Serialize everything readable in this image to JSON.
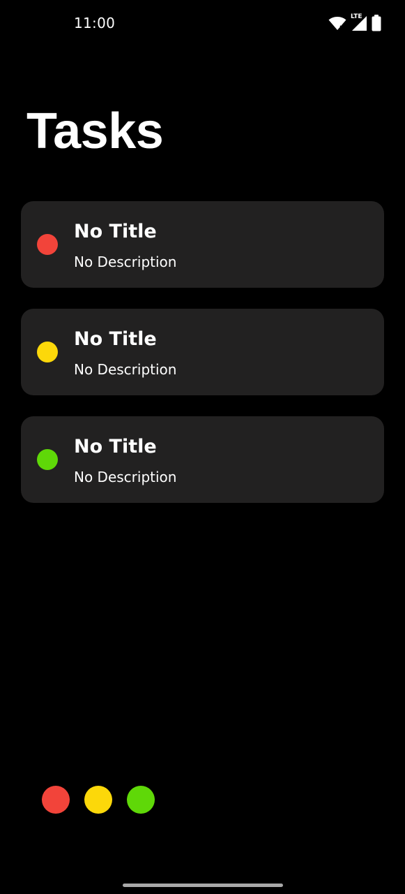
{
  "status_bar": {
    "time": "11:00",
    "network_label": "LTE",
    "icons": [
      "wifi-icon",
      "cell-signal-icon",
      "battery-icon"
    ]
  },
  "header": {
    "title": "Tasks"
  },
  "tasks": [
    {
      "title": "No Title",
      "description": "No Description",
      "color": "#f2443a"
    },
    {
      "title": "No Title",
      "description": "No Description",
      "color": "#fcd80a"
    },
    {
      "title": "No Title",
      "description": "No Description",
      "color": "#5fd808"
    }
  ],
  "color_filter": {
    "options": [
      {
        "name": "red",
        "color": "#f2443a"
      },
      {
        "name": "yellow",
        "color": "#fcd80a"
      },
      {
        "name": "green",
        "color": "#5fd808"
      }
    ]
  },
  "theme": {
    "background": "#000000",
    "card": "#222121",
    "text": "#ffffff"
  }
}
